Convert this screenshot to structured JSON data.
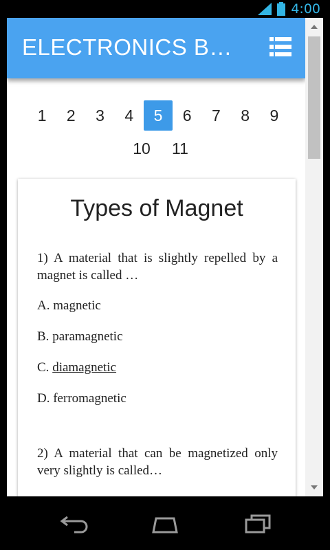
{
  "status_bar": {
    "time": "4:00",
    "icons": [
      "signal-icon",
      "battery-icon"
    ]
  },
  "app_bar": {
    "title": "ELECTRONICS B…",
    "menu_icon": "list-icon",
    "color": "#4aa3f0"
  },
  "pager": {
    "pages": [
      "1",
      "2",
      "3",
      "4",
      "5",
      "6",
      "7",
      "8",
      "9"
    ],
    "pages_row2": [
      "10",
      "11"
    ],
    "active": "5",
    "active_color": "#3d9ae8"
  },
  "content": {
    "title": "Types of Magnet",
    "questions": [
      {
        "text": "1) A material that is slightly repelled by a magnet is called …",
        "options": [
          {
            "letter": "A.",
            "text": "magnetic"
          },
          {
            "letter": "B.",
            "text": "paramagnetic"
          },
          {
            "letter": "C.",
            "text": "diamagnetic"
          },
          {
            "letter": "D.",
            "text": "ferromagnetic"
          }
        ],
        "answer": "C."
      },
      {
        "text": "2) A material that can be magnetized only very slightly is called…"
      }
    ]
  },
  "nav_bar": {
    "icons": [
      "back-icon",
      "home-icon",
      "recents-icon"
    ]
  }
}
